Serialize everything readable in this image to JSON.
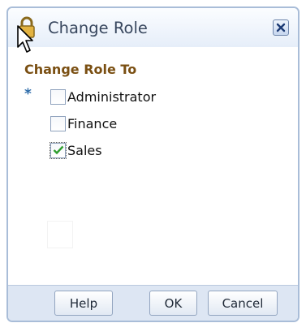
{
  "dialog": {
    "title": "Change Role",
    "close_icon": "close-x-icon",
    "title_icon": "lock-icon",
    "cursor": "arrow-cursor-icon"
  },
  "form": {
    "section_label": "Change Role To",
    "required_marker": "*",
    "options": [
      {
        "label": "Administrator",
        "checked": false
      },
      {
        "label": "Finance",
        "checked": false
      },
      {
        "label": "Sales",
        "checked": true
      }
    ]
  },
  "footer": {
    "help_label": "Help",
    "ok_label": "OK",
    "cancel_label": "Cancel"
  },
  "colors": {
    "accent_label": "#7a4f12",
    "required": "#2b6aa8",
    "check": "#2e9e2e",
    "border": "#a9bdd8"
  }
}
